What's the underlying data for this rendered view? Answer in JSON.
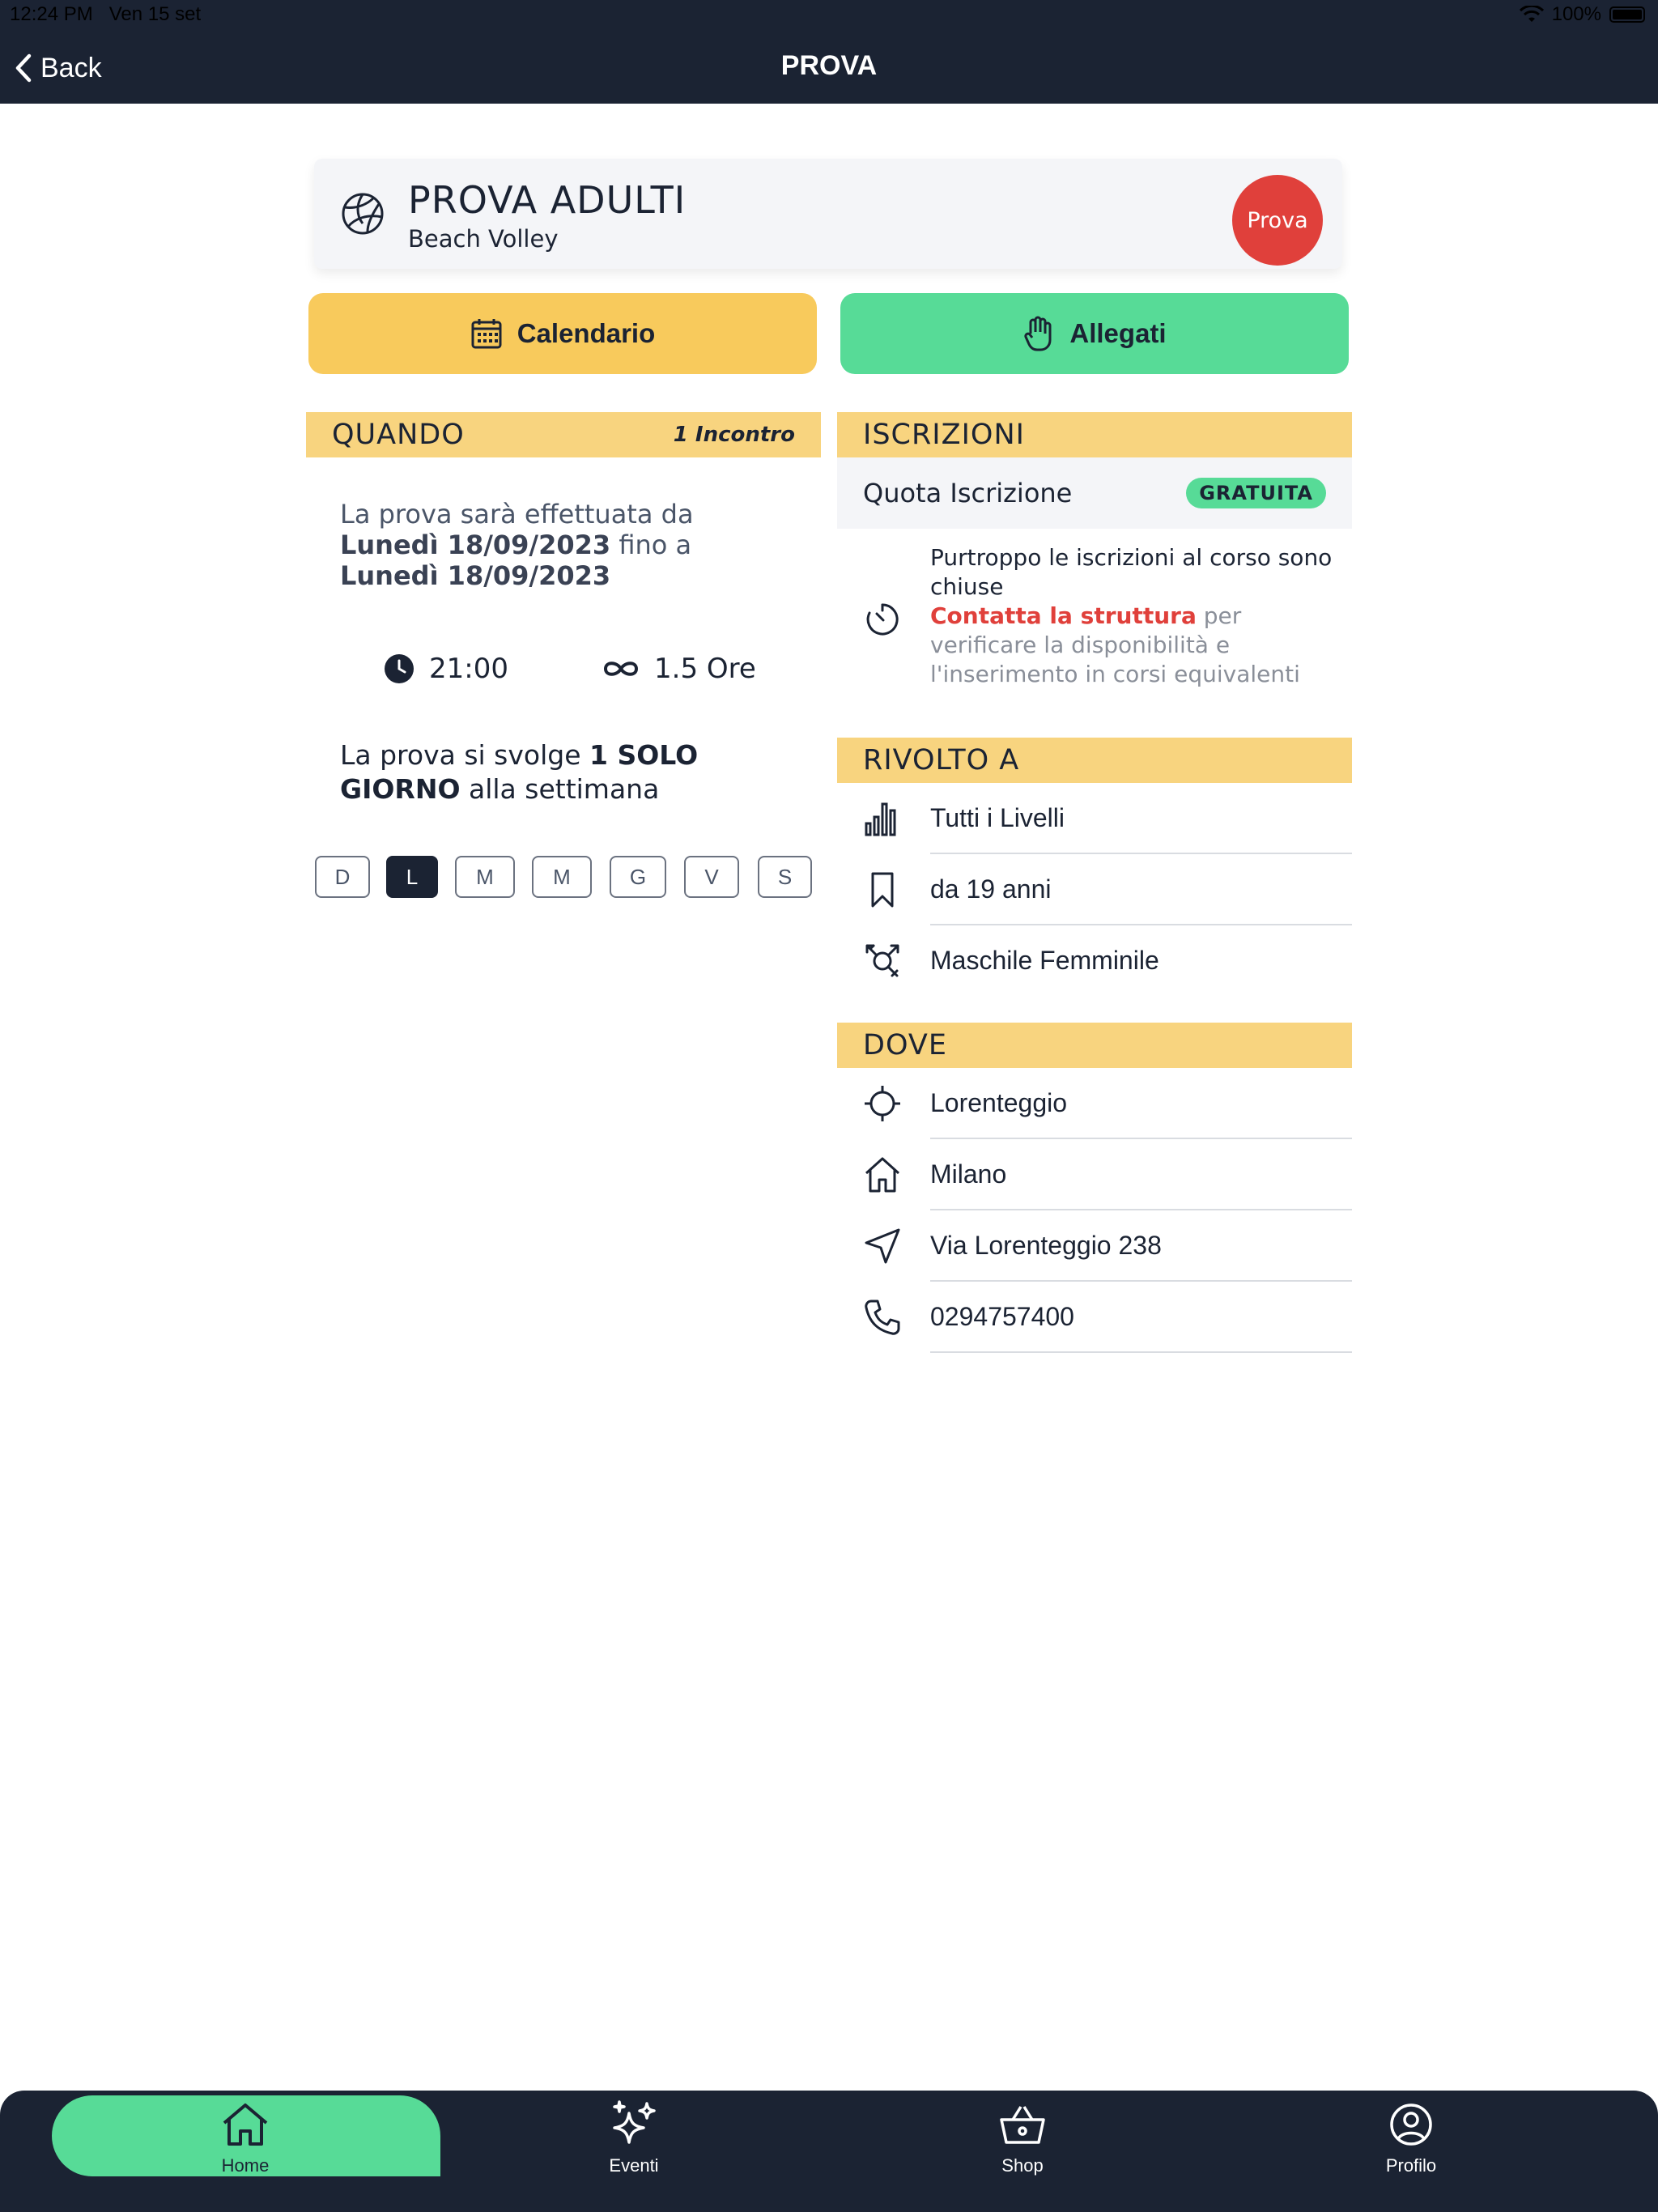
{
  "status_bar": {
    "time": "12:24 PM",
    "date": "Ven 15 set",
    "battery": "100%"
  },
  "nav": {
    "back_label": "Back",
    "title": "PROVA"
  },
  "course": {
    "title": "PROVA ADULTI",
    "subtitle": "Beach Volley",
    "badge": "Prova",
    "icon": "volleyball-icon"
  },
  "actions": {
    "calendar_label": "Calendario",
    "attachments_label": "Allegati"
  },
  "quando": {
    "header": "QUANDO",
    "meetings": "1 Incontro",
    "text_prefix": "La prova sarà effettuata da ",
    "start_date": "Lunedì 18/09/2023",
    "text_middle": " fino a ",
    "end_date": "Lunedì 18/09/2023",
    "time": "21:00",
    "duration": "1.5 Ore",
    "frequency_prefix": "La prova si svolge ",
    "frequency_bold": "1 SOLO GIORNO",
    "frequency_suffix": " alla settimana",
    "days": [
      {
        "label": "D",
        "active": false
      },
      {
        "label": "L",
        "active": true
      },
      {
        "label": "M",
        "active": false
      },
      {
        "label": "M",
        "active": false
      },
      {
        "label": "G",
        "active": false
      },
      {
        "label": "V",
        "active": false
      },
      {
        "label": "S",
        "active": false
      }
    ]
  },
  "iscrizioni": {
    "header": "ISCRIZIONI",
    "fee_label": "Quota Iscrizione",
    "fee_badge": "GRATUITA",
    "closed_text": "Purtroppo le iscrizioni al corso sono chiuse",
    "contact_link": "Contatta la struttura",
    "contact_rest": " per verificare la disponibilità e l'inserimento in corsi equivalenti"
  },
  "rivolto": {
    "header": "RIVOLTO A",
    "level": "Tutti i Livelli",
    "age": "da 19 anni",
    "gender": "Maschile Femminile"
  },
  "dove": {
    "header": "DOVE",
    "location": "Lorenteggio",
    "city": "Milano",
    "address": "Via Lorenteggio 238",
    "phone": "0294757400"
  },
  "tabs": [
    {
      "label": "Home",
      "icon": "home-icon",
      "active": true
    },
    {
      "label": "Eventi",
      "icon": "sparkles-icon",
      "active": false
    },
    {
      "label": "Shop",
      "icon": "basket-icon",
      "active": false
    },
    {
      "label": "Profilo",
      "icon": "user-circle-icon",
      "active": false
    }
  ],
  "colors": {
    "navy": "#1b2333",
    "yellow": "#f8ca5c",
    "green": "#57db97",
    "red": "#e0403b",
    "section": "#f8d47f"
  }
}
